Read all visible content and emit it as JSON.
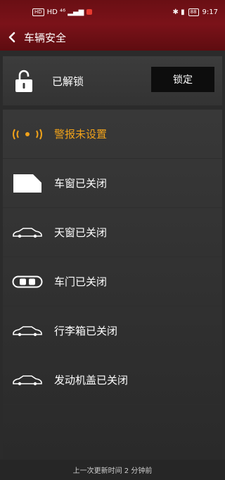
{
  "status_bar": {
    "signal": "HD ⁴⁶ ▂▄▆",
    "icons": "✱ ▮",
    "battery": "88",
    "time": "9:17"
  },
  "header": {
    "title": "车辆安全"
  },
  "lock": {
    "state": "已解锁",
    "button_label": "锁定"
  },
  "statuses": [
    {
      "icon": "alarm-icon",
      "label": "警报未设置"
    },
    {
      "icon": "window-icon",
      "label": "车窗已关闭"
    },
    {
      "icon": "sunroof-car-icon",
      "label": "天窗已关闭"
    },
    {
      "icon": "door-icon",
      "label": "车门已关闭"
    },
    {
      "icon": "trunk-car-icon",
      "label": "行李箱已关闭"
    },
    {
      "icon": "hood-car-icon",
      "label": "发动机盖已关闭"
    }
  ],
  "footer": {
    "updated": "上一次更新时间 2 分钟前"
  },
  "colors": {
    "header": "#7b1219",
    "alert": "#f0a21a",
    "background": "#2b2b2b"
  }
}
